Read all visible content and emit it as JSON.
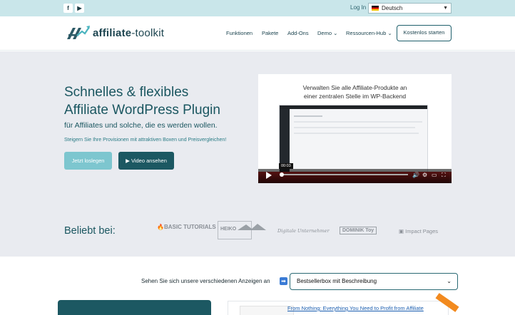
{
  "topbar": {
    "social": [
      {
        "label": "f",
        "icon": "facebook-icon"
      },
      {
        "label": "▶",
        "icon": "youtube-icon"
      }
    ],
    "login": "Log In",
    "language": "Deutsch"
  },
  "header": {
    "logo_text_bold": "affiliate",
    "logo_text_rest": "-toolkit",
    "nav": [
      "Funktionen",
      "Pakete",
      "Add-Ons",
      "Demo ⌄",
      "Ressourcen-Hub ⌄"
    ],
    "cta": "Kostenlos starten"
  },
  "hero": {
    "title_line1": "Schnelles & flexibles",
    "title_line2": "Affiliate WordPress Plugin",
    "subtitle": "für Affiliates und solche, die es werden wollen.",
    "tagline": "Steigern Sie Ihre Provisionen mit attraktiven Boxen und Preisvergleichen!",
    "btn_primary": "Jetzt loslegen",
    "btn_secondary": "Video ansehen",
    "video": {
      "caption_line1": "Verwalten Sie alle Affiliate-Produkte an",
      "caption_line2": "einer zentralen Stelle im WP-Backend",
      "time": "00:03"
    }
  },
  "partners": {
    "label": "Beliebt bei:",
    "logos": [
      "BASIC TUTORIALS",
      "HEIKO",
      "Digitale Unternehmer",
      "DOMINIK Toy",
      "Impact Pages"
    ]
  },
  "below": {
    "prompt": "Sehen Sie sich unsere verschiedenen Anzeigen an",
    "arrow": "➡",
    "select_value": "Bestsellerbox mit Beschreibung",
    "product_title": "From Nothing: Everything You Need to Profit from Affiliate"
  },
  "colors": {
    "topbar": "#c9e6ea",
    "hero_bg": "#e9ebf0",
    "primary_dark": "#1c5862",
    "primary_light": "#7dc6cf"
  }
}
